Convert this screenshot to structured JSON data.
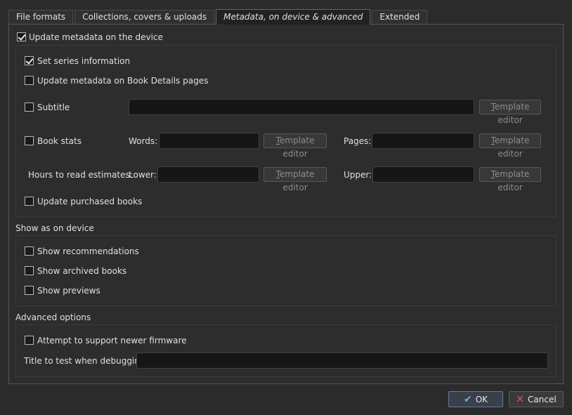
{
  "tabs": [
    {
      "label": "File formats"
    },
    {
      "label": "Collections, covers & uploads"
    },
    {
      "label": "Metadata, on device & advanced"
    },
    {
      "label": "Extended"
    }
  ],
  "metadata": {
    "update_label": "Update metadata on the device",
    "series_label": "Set series information",
    "book_details_label": "Update metadata on Book Details pages",
    "subtitle_label": "Subtitle",
    "book_stats_label": "Book stats",
    "words_label": "Words:",
    "pages_label": "Pages:",
    "hours_label": "Hours to read estimates:",
    "lower_label": "Lower:",
    "upper_label": "Upper:",
    "purchased_label": "Update purchased books",
    "template_editor_label": "Template editor"
  },
  "show": {
    "heading": "Show as on device",
    "recommendations_label": "Show recommendations",
    "archived_label": "Show archived books",
    "previews_label": "Show previews"
  },
  "advanced": {
    "heading": "Advanced options",
    "firmware_label": "Attempt to support newer firmware",
    "debug_title_label": "Title to test when debugging:"
  },
  "buttons": {
    "ok": "OK",
    "cancel": "Cancel"
  }
}
